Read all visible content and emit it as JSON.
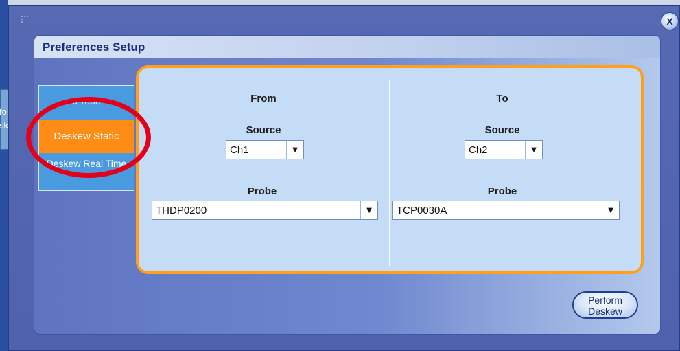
{
  "background": {
    "left_tab_lines": [
      "fo",
      "sk"
    ]
  },
  "dialog": {
    "title": "Preferences Setup",
    "close_label": "X"
  },
  "tabs": {
    "iprobe": "IProbe",
    "deskew_static": "Deskew Static",
    "deskew_realtime": "Deskew Real Time"
  },
  "from": {
    "heading": "From",
    "source_label": "Source",
    "source_value": "Ch1",
    "probe_label": "Probe",
    "probe_value": "THDP0200"
  },
  "to": {
    "heading": "To",
    "source_label": "Source",
    "source_value": "Ch2",
    "probe_label": "Probe",
    "probe_value": "TCP0030A"
  },
  "dropdown_arrow": "▼",
  "perform_button": {
    "line1": "Perform",
    "line2": "Deskew"
  },
  "colors": {
    "accent_orange": "#ff8c14",
    "highlight_red": "#e3001a",
    "panel_blue": "#5669b3"
  }
}
